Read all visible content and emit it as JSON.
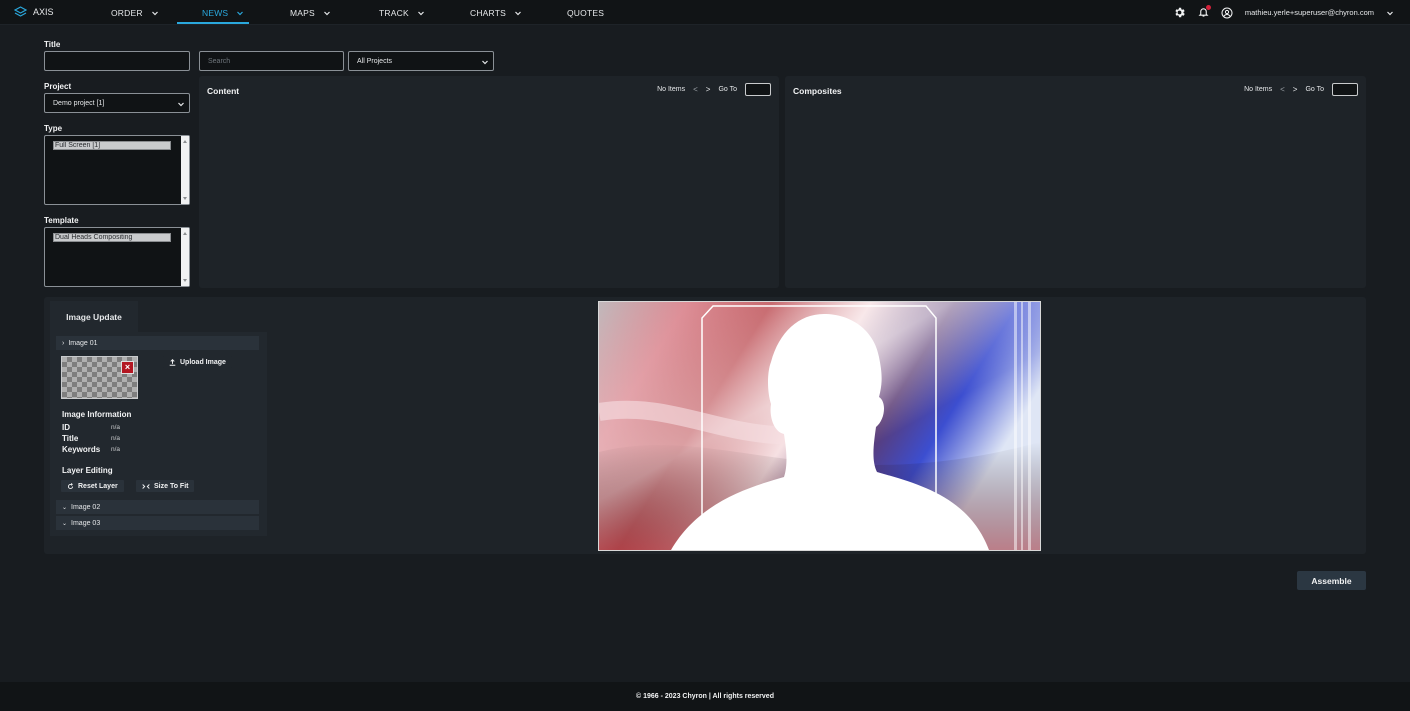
{
  "app": {
    "name": "AXIS"
  },
  "nav": {
    "items": [
      {
        "label": "ORDER"
      },
      {
        "label": "NEWS"
      },
      {
        "label": "MAPS"
      },
      {
        "label": "TRACK"
      },
      {
        "label": "CHARTS"
      },
      {
        "label": "QUOTES"
      }
    ],
    "active": "NEWS",
    "user_email": "mathieu.yerle+superuser@chyron.com"
  },
  "filters": {
    "title_label": "Title",
    "title_value": "",
    "search_placeholder": "Search",
    "projects_select": "All Projects",
    "project_label": "Project",
    "project_value": "Demo project [1]",
    "type_label": "Type",
    "type_option": "Full Screen [1]",
    "template_label": "Template",
    "template_option": "Dual Heads Compositing"
  },
  "content_panel": {
    "title": "Content",
    "no_items": "No Items",
    "prev": "<",
    "next": ">",
    "goto": "Go To"
  },
  "composites_panel": {
    "title": "Composites",
    "no_items": "No Items",
    "prev": "<",
    "next": ">",
    "goto": "Go To"
  },
  "image_update": {
    "tab": "Image Update",
    "image01": "Image 01",
    "upload": "Upload Image",
    "info_heading": "Image Information",
    "id_label": "ID",
    "id_value": "n/a",
    "title_label": "Title",
    "title_value": "n/a",
    "keywords_label": "Keywords",
    "keywords_value": "n/a",
    "layer_heading": "Layer Editing",
    "reset_layer": "Reset Layer",
    "size_to_fit": "Size To Fit",
    "image02": "Image 02",
    "image03": "Image 03"
  },
  "assemble_label": "Assemble",
  "footer": "© 1966 - 2023 Chyron | All rights reserved",
  "colors": {
    "accent": "#2aa8dd",
    "background": "#181c20",
    "panel": "#1e2328",
    "danger": "#b31722"
  }
}
